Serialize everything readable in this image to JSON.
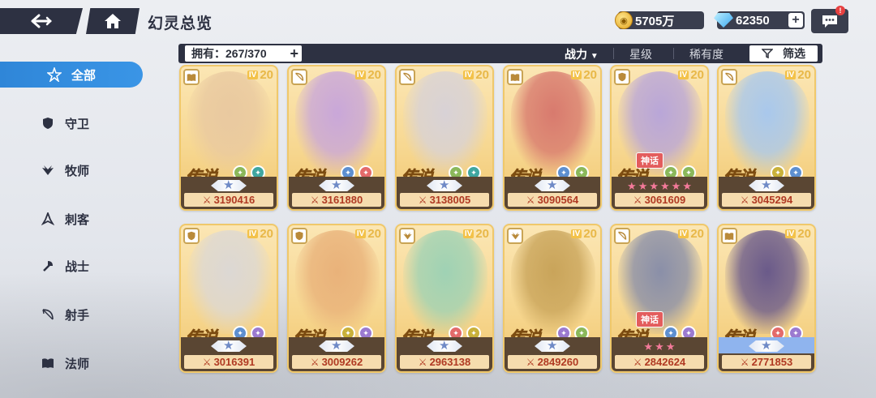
{
  "header": {
    "title": "幻灵总览",
    "gold": "5705万",
    "gems": "62350",
    "chat_badge": "!"
  },
  "filter_bar": {
    "owned_label": "拥有：267/370",
    "sort_power": "战力",
    "sort_star": "星级",
    "sort_rarity": "稀有度",
    "filter_label": "筛选"
  },
  "sidebar": {
    "items": [
      {
        "label": "全部",
        "icon": "star-outline-icon",
        "active": true
      },
      {
        "label": "守卫",
        "icon": "shield-icon",
        "active": false
      },
      {
        "label": "牧师",
        "icon": "wing-icon",
        "active": false
      },
      {
        "label": "刺客",
        "icon": "dagger-icon",
        "active": false
      },
      {
        "label": "战士",
        "icon": "axe-icon",
        "active": false
      },
      {
        "label": "射手",
        "icon": "bow-icon",
        "active": false
      },
      {
        "label": "法师",
        "icon": "book-icon",
        "active": false
      }
    ]
  },
  "cards": [
    {
      "class": "book-icon",
      "level": "20",
      "rank": "传说",
      "elems": [
        "#8bb85a",
        "#3fa6a0"
      ],
      "mythic": "",
      "stars": 0,
      "power": "3190416",
      "art": "#e9c9a0"
    },
    {
      "class": "bow-icon",
      "level": "20",
      "rank": "传说",
      "elems": [
        "#5d8fd0",
        "#e36a6a"
      ],
      "mythic": "",
      "stars": 0,
      "power": "3161880",
      "art": "#c9a7d9"
    },
    {
      "class": "bow-icon",
      "level": "20",
      "rank": "传说",
      "elems": [
        "#8bb85a",
        "#3fa6a0"
      ],
      "mythic": "",
      "stars": 0,
      "power": "3138005",
      "art": "#d8d2d6"
    },
    {
      "class": "book-icon",
      "level": "20",
      "rank": "传说",
      "elems": [
        "#5d8fd0",
        "#8bb85a"
      ],
      "mythic": "",
      "stars": 0,
      "power": "3090564",
      "art": "#d87a6e"
    },
    {
      "class": "shield-icon",
      "level": "20",
      "rank": "传说",
      "elems": [
        "#8bb85a",
        "#8bb85a"
      ],
      "mythic": "神话",
      "stars": 6,
      "power": "3061609",
      "art": "#b9a6d8"
    },
    {
      "class": "bow-icon",
      "level": "20",
      "rank": "传说",
      "elems": [
        "#c9b13a",
        "#5d8fd0"
      ],
      "mythic": "",
      "stars": 0,
      "power": "3045294",
      "art": "#a9c8ec"
    },
    {
      "class": "shield-icon",
      "level": "20",
      "rank": "传说",
      "elems": [
        "#5d8fd0",
        "#9b7ad0"
      ],
      "mythic": "",
      "stars": 0,
      "power": "3016391",
      "art": "#dcd8d4"
    },
    {
      "class": "shield-icon",
      "level": "20",
      "rank": "传说",
      "elems": [
        "#c9b13a",
        "#9b7ad0"
      ],
      "mythic": "",
      "stars": 0,
      "power": "3009262",
      "art": "#e9b27a"
    },
    {
      "class": "wing-icon",
      "level": "20",
      "rank": "传说",
      "elems": [
        "#e36a6a",
        "#c9b13a"
      ],
      "mythic": "",
      "stars": 0,
      "power": "2963138",
      "art": "#9fd2b4"
    },
    {
      "class": "wing-icon",
      "level": "20",
      "rank": "传说",
      "elems": [
        "#9b7ad0",
        "#8bb85a"
      ],
      "mythic": "",
      "stars": 0,
      "power": "2849260",
      "art": "#c9a45a"
    },
    {
      "class": "bow-icon",
      "level": "20",
      "rank": "传说",
      "elems": [
        "#5d8fd0",
        "#9b7ad0"
      ],
      "mythic": "神话",
      "stars": 3,
      "power": "2842624",
      "art": "#8a8fa8"
    },
    {
      "class": "book-icon",
      "level": "20",
      "rank": "传说",
      "elems": [
        "#e36a6a",
        "#9b7ad0"
      ],
      "mythic": "",
      "stars": 0,
      "power": "2771853",
      "art": "#6a5a8a"
    }
  ],
  "colors": {
    "accent": "#2f86d8",
    "dark": "#2d3142",
    "card_border": "#f0c86a",
    "power_text": "#b03a23"
  }
}
